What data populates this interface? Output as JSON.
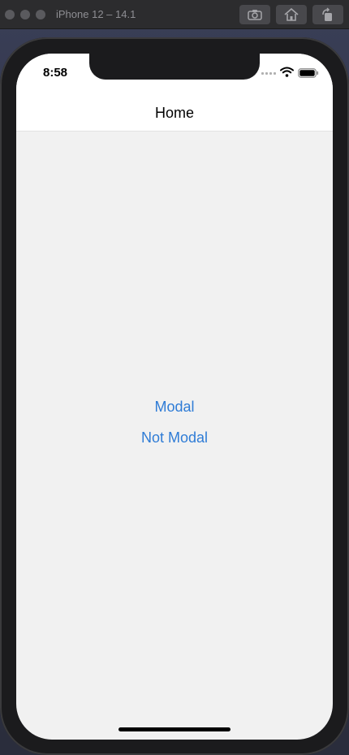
{
  "simulator": {
    "title": "iPhone 12 – 14.1",
    "buttons": [
      "screenshot-icon",
      "home-icon",
      "rotate-icon"
    ]
  },
  "status_bar": {
    "time": "8:58"
  },
  "nav": {
    "title": "Home"
  },
  "content": {
    "modal_label": "Modal",
    "not_modal_label": "Not Modal"
  },
  "colors": {
    "link": "#2f7cd6",
    "background": "#f1f1f1",
    "navbar": "#ffffff"
  }
}
